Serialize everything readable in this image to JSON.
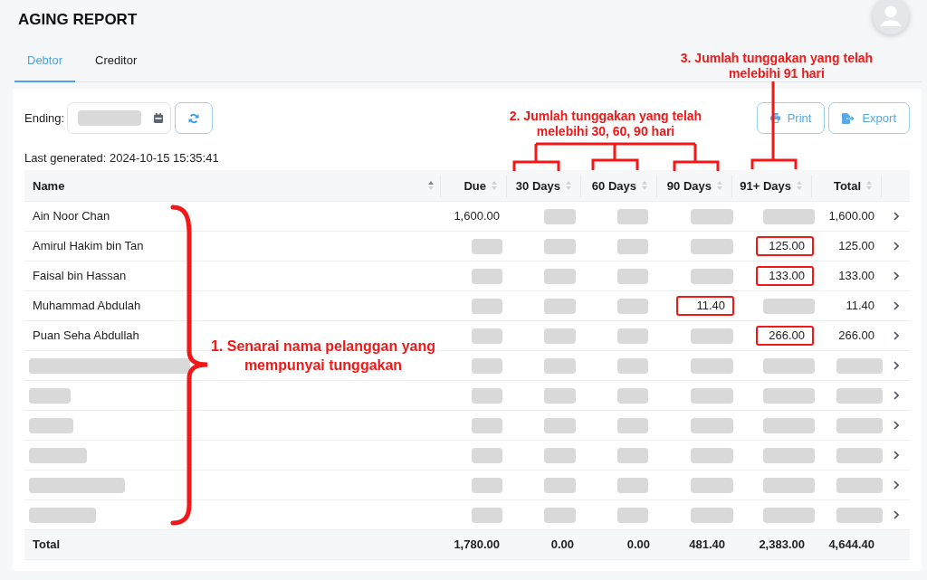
{
  "title": "AGING REPORT",
  "tabs": [
    {
      "label": "Debtor",
      "selected": true
    },
    {
      "label": "Creditor",
      "selected": false
    }
  ],
  "filter": {
    "label": "Ending:",
    "date_redacted": true
  },
  "actions": [
    {
      "kind": "print",
      "label": "Print"
    },
    {
      "kind": "export",
      "label": "Export"
    }
  ],
  "last_generated": "Last generated: 2024-10-15 15:35:41",
  "table": {
    "columns": [
      {
        "label": "Name",
        "sorted": true
      },
      {
        "label": "Due",
        "sorted": false
      },
      {
        "label": "30 Days",
        "sorted": false
      },
      {
        "label": "60 Days",
        "sorted": false
      },
      {
        "label": "90 Days",
        "sorted": false
      },
      {
        "label": "91+ Days",
        "sorted": false
      },
      {
        "label": "Total",
        "sorted": false
      }
    ],
    "rows": [
      {
        "cells": [
          {
            "kind": "text",
            "text": "Ain Noor Chan",
            "highlighted": false
          },
          {
            "kind": "text",
            "text": "1,600.00",
            "highlighted": false
          },
          {
            "kind": "redacted",
            "highlighted": false
          },
          {
            "kind": "redacted",
            "highlighted": false
          },
          {
            "kind": "redacted",
            "highlighted": false
          },
          {
            "kind": "redacted",
            "highlighted": false
          },
          {
            "kind": "text",
            "text": "1,600.00",
            "highlighted": false
          }
        ]
      },
      {
        "cells": [
          {
            "kind": "text",
            "text": "Amirul Hakim bin Tan",
            "highlighted": false
          },
          {
            "kind": "redacted",
            "highlighted": false
          },
          {
            "kind": "redacted",
            "highlighted": false
          },
          {
            "kind": "redacted",
            "highlighted": false
          },
          {
            "kind": "redacted",
            "highlighted": false
          },
          {
            "kind": "text",
            "text": "125.00",
            "highlighted": true
          },
          {
            "kind": "text",
            "text": "125.00",
            "highlighted": false
          }
        ]
      },
      {
        "cells": [
          {
            "kind": "text",
            "text": "Faisal bin Hassan",
            "highlighted": false
          },
          {
            "kind": "redacted",
            "highlighted": false
          },
          {
            "kind": "redacted",
            "highlighted": false
          },
          {
            "kind": "redacted",
            "highlighted": false
          },
          {
            "kind": "redacted",
            "highlighted": false
          },
          {
            "kind": "text",
            "text": "133.00",
            "highlighted": true
          },
          {
            "kind": "text",
            "text": "133.00",
            "highlighted": false
          }
        ]
      },
      {
        "cells": [
          {
            "kind": "text",
            "text": "Muhammad Abdulah",
            "highlighted": false
          },
          {
            "kind": "redacted",
            "highlighted": false
          },
          {
            "kind": "redacted",
            "highlighted": false
          },
          {
            "kind": "redacted",
            "highlighted": false
          },
          {
            "kind": "text",
            "text": "11.40",
            "highlighted": true
          },
          {
            "kind": "redacted",
            "highlighted": false
          },
          {
            "kind": "text",
            "text": "11.40",
            "highlighted": false
          }
        ]
      },
      {
        "cells": [
          {
            "kind": "text",
            "text": "Puan Seha Abdullah",
            "highlighted": false
          },
          {
            "kind": "redacted",
            "highlighted": false
          },
          {
            "kind": "redacted",
            "highlighted": false
          },
          {
            "kind": "redacted",
            "highlighted": false
          },
          {
            "kind": "redacted",
            "highlighted": false
          },
          {
            "kind": "text",
            "text": "266.00",
            "highlighted": true
          },
          {
            "kind": "text",
            "text": "266.00",
            "highlighted": false
          }
        ]
      },
      {
        "cells": [
          {
            "kind": "redacted",
            "highlighted": false
          },
          {
            "kind": "redacted",
            "highlighted": false
          },
          {
            "kind": "redacted",
            "highlighted": false
          },
          {
            "kind": "redacted",
            "highlighted": false
          },
          {
            "kind": "redacted",
            "highlighted": false
          },
          {
            "kind": "redacted",
            "highlighted": false
          },
          {
            "kind": "redacted",
            "highlighted": false
          }
        ]
      },
      {
        "cells": [
          {
            "kind": "redacted",
            "highlighted": false
          },
          {
            "kind": "redacted",
            "highlighted": false
          },
          {
            "kind": "redacted",
            "highlighted": false
          },
          {
            "kind": "redacted",
            "highlighted": false
          },
          {
            "kind": "redacted",
            "highlighted": false
          },
          {
            "kind": "redacted",
            "highlighted": false
          },
          {
            "kind": "redacted",
            "highlighted": false
          }
        ]
      },
      {
        "cells": [
          {
            "kind": "redacted",
            "highlighted": false
          },
          {
            "kind": "redacted",
            "highlighted": false
          },
          {
            "kind": "redacted",
            "highlighted": false
          },
          {
            "kind": "redacted",
            "highlighted": false
          },
          {
            "kind": "redacted",
            "highlighted": false
          },
          {
            "kind": "redacted",
            "highlighted": false
          },
          {
            "kind": "redacted",
            "highlighted": false
          }
        ]
      },
      {
        "cells": [
          {
            "kind": "redacted",
            "highlighted": false
          },
          {
            "kind": "redacted",
            "highlighted": false
          },
          {
            "kind": "redacted",
            "highlighted": false
          },
          {
            "kind": "redacted",
            "highlighted": false
          },
          {
            "kind": "redacted",
            "highlighted": false
          },
          {
            "kind": "redacted",
            "highlighted": false
          },
          {
            "kind": "redacted",
            "highlighted": false
          }
        ]
      },
      {
        "cells": [
          {
            "kind": "redacted",
            "highlighted": false
          },
          {
            "kind": "redacted",
            "highlighted": false
          },
          {
            "kind": "redacted",
            "highlighted": false
          },
          {
            "kind": "redacted",
            "highlighted": false
          },
          {
            "kind": "redacted",
            "highlighted": false
          },
          {
            "kind": "redacted",
            "highlighted": false
          },
          {
            "kind": "redacted",
            "highlighted": false
          }
        ]
      },
      {
        "cells": [
          {
            "kind": "redacted",
            "highlighted": false
          },
          {
            "kind": "redacted",
            "highlighted": false
          },
          {
            "kind": "redacted",
            "highlighted": false
          },
          {
            "kind": "redacted",
            "highlighted": false
          },
          {
            "kind": "redacted",
            "highlighted": false
          },
          {
            "kind": "redacted",
            "highlighted": false
          },
          {
            "kind": "redacted",
            "highlighted": false
          }
        ]
      }
    ],
    "totals": {
      "label": "Total",
      "values": [
        "1,780.00",
        "0.00",
        "0.00",
        "481.40",
        "2,383.00",
        "4,644.40"
      ]
    }
  },
  "annotations": [
    {
      "kind": "brace",
      "text": "1. Senarai nama pelanggan yang mempunyai tunggakan"
    },
    {
      "kind": "bracket_group",
      "text": "2. Jumlah tunggakan yang telah melebihi 30, 60, 90 hari"
    },
    {
      "kind": "bracket",
      "text": "3. Jumlah tunggakan yang telah melebihi 91 hari"
    }
  ]
}
